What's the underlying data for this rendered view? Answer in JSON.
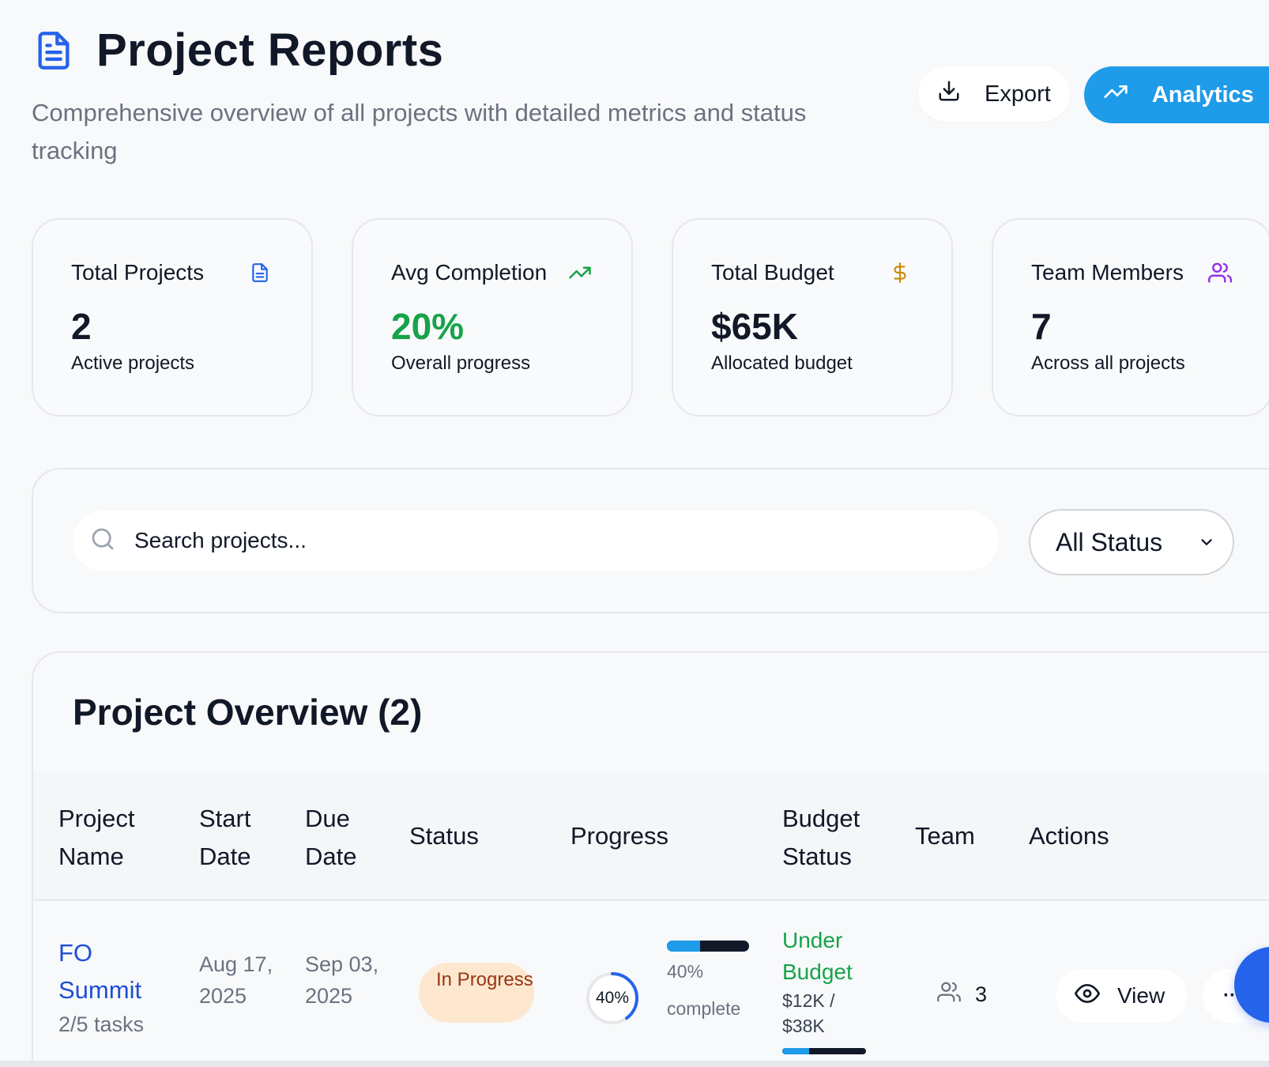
{
  "header": {
    "title": "Project Reports",
    "subtitle": "Comprehensive overview of all projects with detailed metrics and status tracking",
    "export_label": "Export",
    "analytics_label": "Analytics",
    "title_icon": "document-icon"
  },
  "stats": [
    {
      "label": "Total Projects",
      "value": "2",
      "desc": "Active projects",
      "icon": "document-icon",
      "color": "#2563eb"
    },
    {
      "label": "Avg Completion",
      "value": "20%",
      "desc": "Overall progress",
      "icon": "trend-up-icon",
      "color": "#16a34a"
    },
    {
      "label": "Total Budget",
      "value": "$65K",
      "desc": "Allocated budget",
      "icon": "dollar-icon",
      "color": "#ca8a04"
    },
    {
      "label": "Team Members",
      "value": "7",
      "desc": "Across all projects",
      "icon": "users-icon",
      "color": "#9333ea"
    }
  ],
  "filters": {
    "search_placeholder": "Search projects...",
    "status_selected": "All Status"
  },
  "table": {
    "title": "Project Overview (2)",
    "columns": [
      "Project\nName",
      "Start\nDate",
      "Due\nDate",
      "Status",
      "Progress",
      "Budget\nStatus",
      "Team",
      "Actions"
    ],
    "rows": [
      {
        "name": "FO Summit",
        "tasks": "2/5 tasks",
        "start": "Aug 17, 2025",
        "due": "Sep 03, 2025",
        "status": "In Progress",
        "progress_label": "40%",
        "progress_text": "40% complete",
        "progress_fraction": 0.4,
        "budget_status": "Under Budget",
        "budget_amount": "$12K / $38K",
        "budget_fraction": 0.32,
        "team": "3",
        "view_label": "View",
        "more_label": "···"
      }
    ]
  },
  "colors": {
    "accent": "#1e9be9",
    "link": "#1d4ed8",
    "success": "#16a34a",
    "badge_bg": "#fde8cf",
    "badge_text": "#9a3412"
  }
}
